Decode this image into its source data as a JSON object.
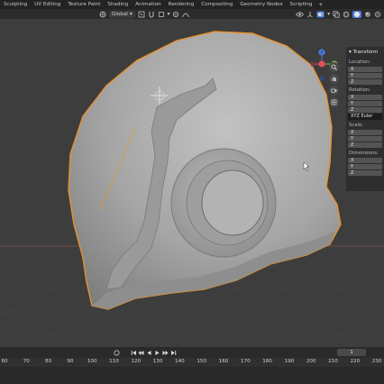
{
  "workspace_tabs": [
    "Sculpting",
    "UV Editing",
    "Texture Paint",
    "Shading",
    "Animation",
    "Rendering",
    "Compositing",
    "Geometry Nodes",
    "Scripting"
  ],
  "workspace_add": "+",
  "header": {
    "transform_orientation": "Global"
  },
  "gizmo": {
    "z_axis": "Z",
    "y_axis": "Y"
  },
  "n_panel": {
    "title": "Transform",
    "location_label": "Location:",
    "rotation_label": "Rotation:",
    "rotation_mode": "XYZ Euler",
    "scale_label": "Scale:",
    "dimensions_label": "Dimensions:",
    "x": "X",
    "y": "Y",
    "z": "Z"
  },
  "timeline": {
    "current_frame": "1",
    "ticks": [
      "60",
      "70",
      "80",
      "90",
      "100",
      "110",
      "120",
      "130",
      "140",
      "150",
      "160",
      "170",
      "180",
      "190",
      "200",
      "210",
      "220",
      "230"
    ]
  },
  "colors": {
    "selection_outline": "#e8922c",
    "axis_x": "#e24d5b",
    "axis_y": "#7fbf3f",
    "axis_z": "#4f7ddc",
    "mesh": "#a6a6a6"
  }
}
